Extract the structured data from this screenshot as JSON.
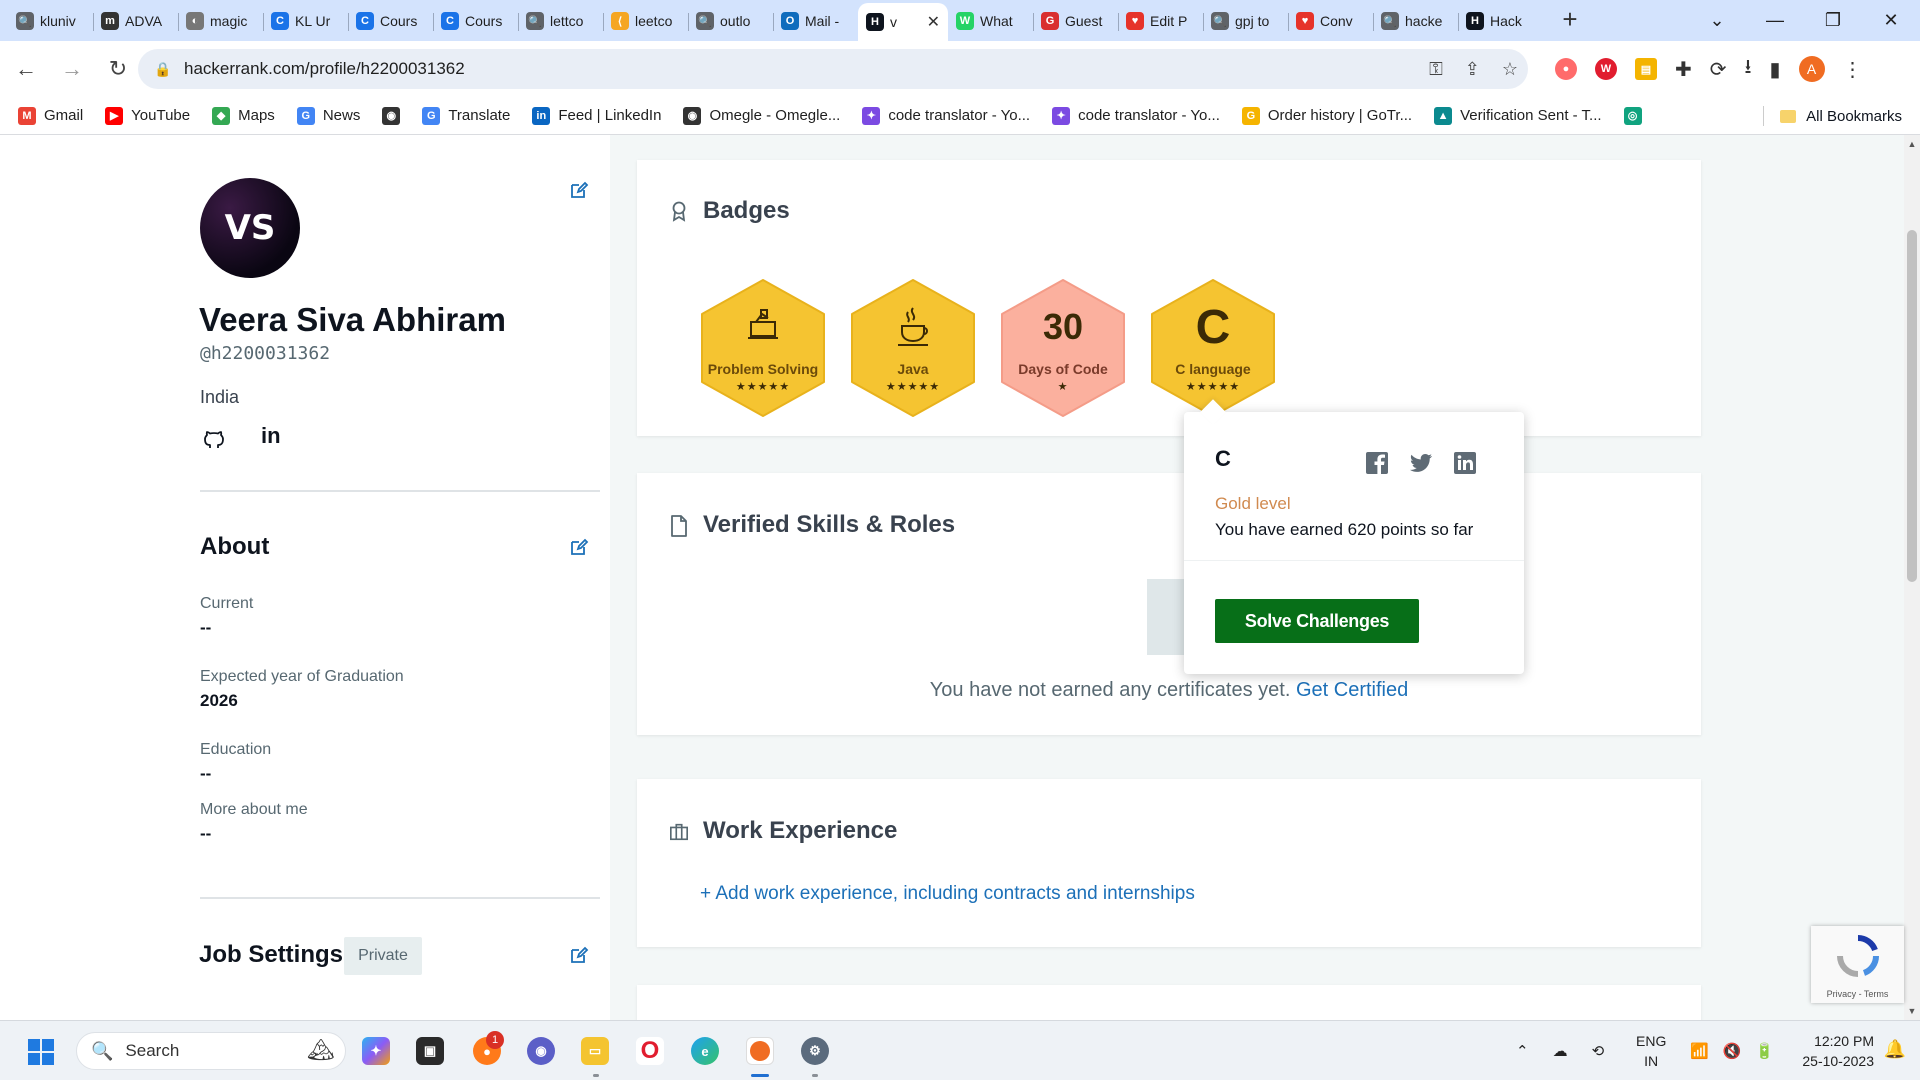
{
  "browser": {
    "tabs": [
      {
        "title": "kluniv",
        "fav": "🔍",
        "color": "#5f6368"
      },
      {
        "title": "ADVA",
        "fav": "m",
        "color": "#333333"
      },
      {
        "title": "magic",
        "fav": "◐",
        "color": "#777777"
      },
      {
        "title": "KL Ur",
        "fav": "C",
        "color": "#1a73e8"
      },
      {
        "title": "Cours",
        "fav": "C",
        "color": "#1a73e8"
      },
      {
        "title": "Cours",
        "fav": "C",
        "color": "#1a73e8"
      },
      {
        "title": "lettco",
        "fav": "🔍",
        "color": "#5f6368"
      },
      {
        "title": "leetco",
        "fav": "⟨",
        "color": "#f5a623"
      },
      {
        "title": "outlo",
        "fav": "🔍",
        "color": "#5f6368"
      },
      {
        "title": "Mail -",
        "fav": "O",
        "color": "#0f6cbd"
      },
      {
        "title": "v",
        "fav": "H",
        "color": "#0e141e",
        "active": true
      },
      {
        "title": "What",
        "fav": "W",
        "color": "#25d366"
      },
      {
        "title": "Guest",
        "fav": "G",
        "color": "#d92f2f"
      },
      {
        "title": "Edit P",
        "fav": "♥",
        "color": "#e6332a"
      },
      {
        "title": "gpj to",
        "fav": "🔍",
        "color": "#5f6368"
      },
      {
        "title": "Conv",
        "fav": "♥",
        "color": "#e6332a"
      },
      {
        "title": "hacke",
        "fav": "🔍",
        "color": "#5f6368"
      },
      {
        "title": "Hack",
        "fav": "H",
        "color": "#0e141e"
      }
    ],
    "url": "hackerrank.com/profile/h2200031362",
    "bookmarks": [
      {
        "label": "Gmail",
        "icon": "M",
        "color": "#ea4335"
      },
      {
        "label": "YouTube",
        "icon": "▶",
        "color": "#ff0000"
      },
      {
        "label": "Maps",
        "icon": "◆",
        "color": "#34a853"
      },
      {
        "label": "News",
        "icon": "G",
        "color": "#4285f4"
      },
      {
        "label": "",
        "icon": "◉",
        "color": "#333333"
      },
      {
        "label": "Translate",
        "icon": "G",
        "color": "#4285f4"
      },
      {
        "label": "Feed | LinkedIn",
        "icon": "in",
        "color": "#0a66c2"
      },
      {
        "label": "Omegle - Omegle...",
        "icon": "◉",
        "color": "#333333"
      },
      {
        "label": "code translator - Yo...",
        "icon": "✦",
        "color": "#7b4ae2"
      },
      {
        "label": "code translator - Yo...",
        "icon": "✦",
        "color": "#7b4ae2"
      },
      {
        "label": "Order history | GoTr...",
        "icon": "G",
        "color": "#f5b400"
      },
      {
        "label": "Verification Sent - T...",
        "icon": "▲",
        "color": "#0b8a8f"
      },
      {
        "label": "",
        "icon": "◎",
        "color": "#10a37f"
      }
    ],
    "all_bookmarks": "All Bookmarks",
    "profile_initial": "A"
  },
  "profile": {
    "avatar_initials": "VS",
    "name": "Veera Siva Abhiram",
    "handle": "@h2200031362",
    "country": "India",
    "linkedin_label": "in",
    "about": {
      "title": "About",
      "current_label": "Current",
      "current_value": "--",
      "grad_label": "Expected year of Graduation",
      "grad_value": "2026",
      "education_label": "Education",
      "education_value": "--",
      "more_label": "More about me",
      "more_value": "--"
    },
    "job_settings": {
      "title": "Job Settings",
      "visibility": "Private"
    }
  },
  "badges": {
    "title": "Badges",
    "items": [
      {
        "name": "Problem Solving",
        "stars": "★★★★★",
        "color": "#f5c431",
        "edge": "#e8b21c"
      },
      {
        "name": "Java",
        "stars": "★★★★★",
        "color": "#f5c431",
        "edge": "#e8b21c"
      },
      {
        "name": "Days of Code",
        "number": "30",
        "stars": "★",
        "color": "#fbb09e",
        "edge": "#f49c88"
      },
      {
        "name": "C language",
        "letter": "C",
        "stars": "★★★★★",
        "color": "#f5c431",
        "edge": "#e8b21c"
      }
    ]
  },
  "popover": {
    "title": "C",
    "level": "Gold level",
    "points_text": "You have earned 620 points so far",
    "button": "Solve Challenges"
  },
  "skills": {
    "title": "Verified Skills & Roles",
    "empty_text": "You have not earned any certificates yet.",
    "link": "Get Certified"
  },
  "work": {
    "title": "Work Experience",
    "add_link": "+ Add work experience, including contracts and internships"
  },
  "recaptcha": {
    "text": "Privacy - Terms"
  },
  "taskbar": {
    "search_placeholder": "Search",
    "lang_top": "ENG",
    "lang_bottom": "IN",
    "time": "12:20 PM",
    "date": "25-10-2023",
    "badge_count": "1"
  }
}
